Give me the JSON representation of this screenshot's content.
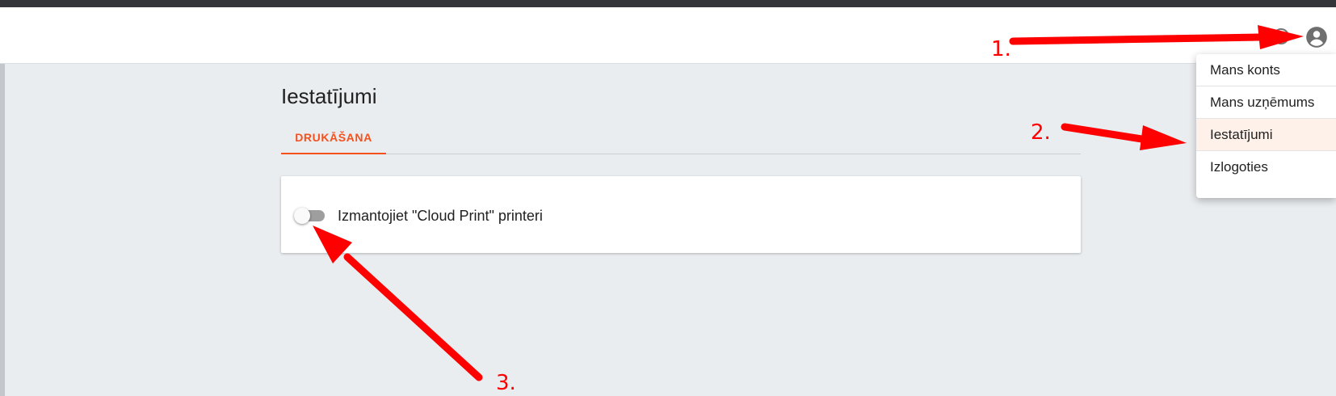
{
  "page": {
    "title": "Iestatījumi",
    "tabs": [
      {
        "label": "DRUKĀŠANA",
        "active": true
      }
    ]
  },
  "settings": {
    "cloud_print": {
      "label": "Izmantojiet \"Cloud Print\" printeri",
      "enabled": false
    }
  },
  "account_menu": {
    "items": [
      {
        "label": "Mans konts"
      },
      {
        "label": "Mans uzņēmums"
      },
      {
        "label": "Iestatījumi",
        "highlighted": true
      },
      {
        "label": "Izlogoties"
      }
    ]
  },
  "annotations": {
    "step1": "1.",
    "step2": "2.",
    "step3": "3."
  },
  "colors": {
    "accent": "#f4511e",
    "annotation": "#ff0000",
    "background": "#eaedf0",
    "appbar": "#ffffff"
  },
  "icons": {
    "help": "help-circle-icon",
    "account": "account-circle-icon"
  }
}
